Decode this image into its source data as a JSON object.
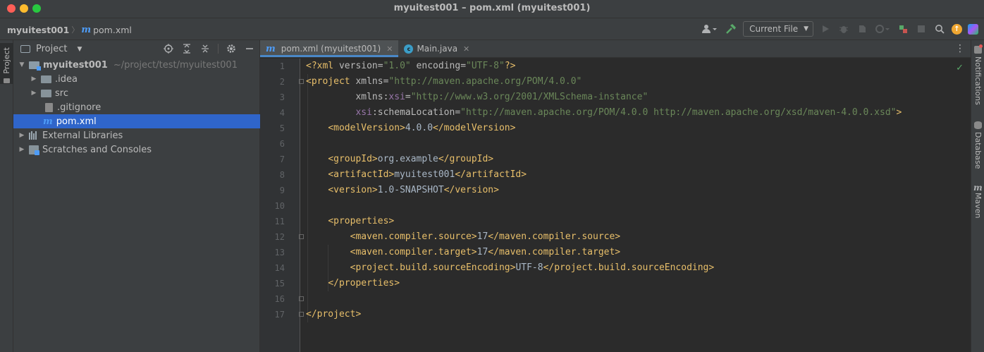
{
  "window": {
    "title": "myuitest001 – pom.xml (myuitest001)"
  },
  "breadcrumb": {
    "project": "myuitest001",
    "file": "pom.xml"
  },
  "toolbar": {
    "run_config": "Current File"
  },
  "left_strip": {
    "project_tab": "Project"
  },
  "project_panel": {
    "title": "Project",
    "tree": [
      {
        "label": "myuitest001",
        "path": "~/project/test/myuitest001"
      },
      {
        "label": ".idea"
      },
      {
        "label": "src"
      },
      {
        "label": ".gitignore"
      },
      {
        "label": "pom.xml"
      },
      {
        "label": "External Libraries"
      },
      {
        "label": "Scratches and Consoles"
      }
    ]
  },
  "editor": {
    "tabs": [
      {
        "label": "pom.xml (myuitest001)"
      },
      {
        "label": "Main.java"
      }
    ],
    "line_numbers": [
      "1",
      "2",
      "3",
      "4",
      "5",
      "6",
      "7",
      "8",
      "9",
      "10",
      "11",
      "12",
      "13",
      "14",
      "15",
      "16",
      "17"
    ],
    "code": {
      "l1": {
        "a": "<?xml ",
        "b": "version",
        "c": "=",
        "d": "\"1.0\"",
        "e": " encoding",
        "f": "=",
        "g": "\"UTF-8\"",
        "h": "?>"
      },
      "l2": {
        "a": "<project ",
        "b": "xmlns",
        "c": "=",
        "d": "\"http://maven.apache.org/POM/4.0.0\""
      },
      "l3": {
        "indent": "         ",
        "a": "xmlns",
        "b": ":",
        "c": "xsi",
        "d": "=",
        "e": "\"http://www.w3.org/2001/XMLSchema-instance\""
      },
      "l4": {
        "indent": "         ",
        "a": "xsi",
        "b": ":schemaLocation",
        "c": "=",
        "d": "\"http://maven.apache.org/POM/4.0.0 http://maven.apache.org/xsd/maven-4.0.0.xsd\"",
        "e": ">"
      },
      "l5": {
        "indent": "    ",
        "a": "<modelVersion>",
        "b": "4.0.0",
        "c": "</modelVersion>"
      },
      "l7": {
        "indent": "    ",
        "a": "<groupId>",
        "b": "org.example",
        "c": "</groupId>"
      },
      "l8": {
        "indent": "    ",
        "a": "<artifactId>",
        "b": "myuitest001",
        "c": "</artifactId>"
      },
      "l9": {
        "indent": "    ",
        "a": "<version>",
        "b": "1.0-SNAPSHOT",
        "c": "</version>"
      },
      "l11": {
        "indent": "    ",
        "a": "<properties>"
      },
      "l12": {
        "indent": "        ",
        "a": "<maven.compiler.source>",
        "b": "17",
        "c": "</maven.compiler.source>"
      },
      "l13": {
        "indent": "        ",
        "a": "<maven.compiler.target>",
        "b": "17",
        "c": "</maven.compiler.target>"
      },
      "l14": {
        "indent": "        ",
        "a": "<project.build.sourceEncoding>",
        "b": "UTF-8",
        "c": "</project.build.sourceEncoding>"
      },
      "l15": {
        "indent": "    ",
        "a": "</properties>"
      },
      "l17": {
        "a": "</project>"
      }
    }
  },
  "right_strip": {
    "notifications": "Notifications",
    "database": "Database",
    "maven": "Maven"
  },
  "colors": {
    "background": "#2b2b2b",
    "panel": "#3c3f41",
    "selection": "#2f65ca",
    "xml_tag": "#e8bf6a",
    "xml_value": "#6a8759",
    "xml_namespace": "#9876aa"
  },
  "icons": {
    "m_logo": "m",
    "java_logo": "c"
  }
}
